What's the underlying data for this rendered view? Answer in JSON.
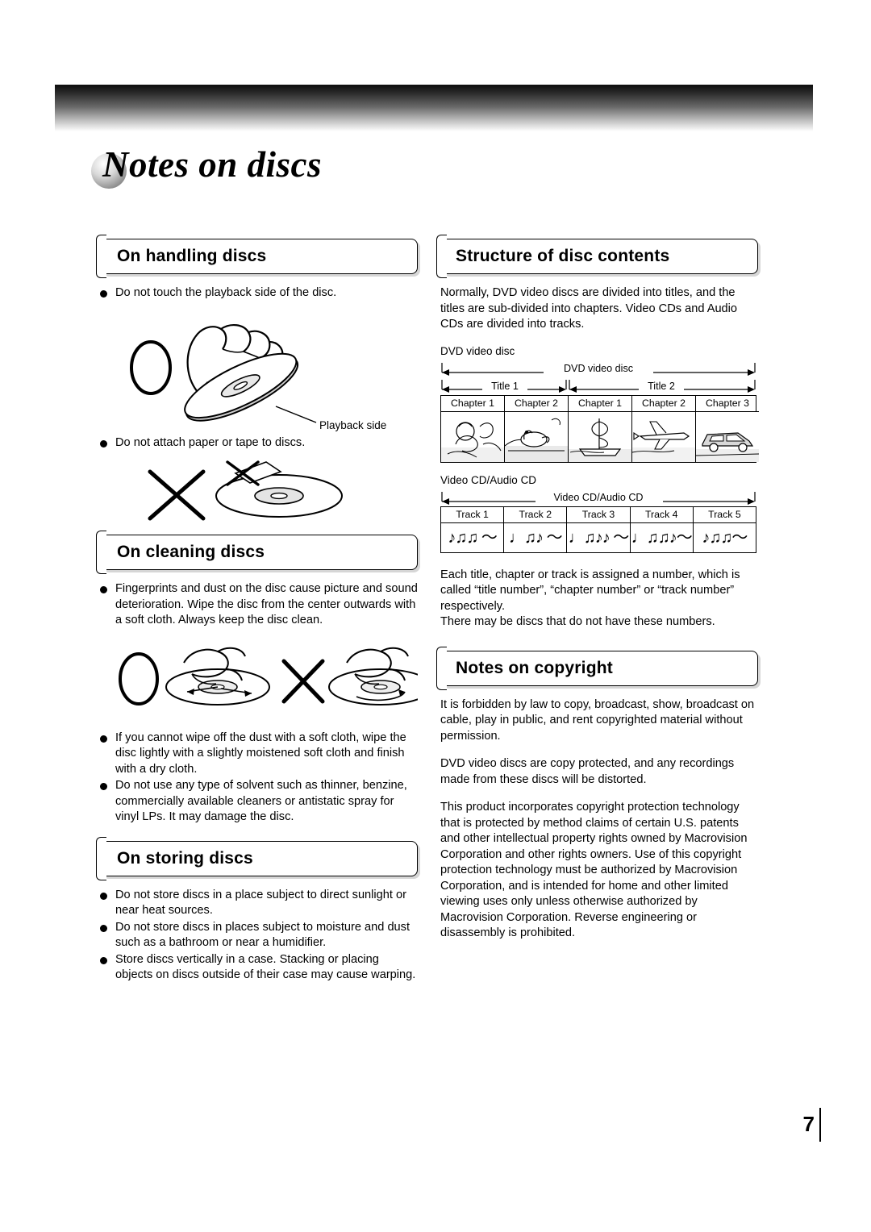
{
  "page": {
    "title": "Notes on discs",
    "number": "7"
  },
  "left": {
    "handling": {
      "heading": "On handling discs",
      "items": [
        "Do not touch the playback side of the disc.",
        "Do not attach paper or tape to discs."
      ],
      "playback_side_label": "Playback side"
    },
    "cleaning": {
      "heading": "On cleaning discs",
      "items": [
        "Fingerprints and dust on the disc cause picture and sound deterioration. Wipe the disc from the center outwards with a soft cloth. Always keep the disc clean.",
        "If you cannot wipe off the dust with a soft cloth, wipe the disc lightly with a slightly moistened soft cloth and finish with a dry cloth.",
        "Do not use any type of solvent such as thinner, benzine, commercially available cleaners or antistatic spray for vinyl LPs. It may damage the disc."
      ]
    },
    "storing": {
      "heading": "On storing discs",
      "items": [
        "Do not store discs in a place subject to direct sunlight or near heat sources.",
        "Do not store discs in places subject to moisture and dust such as a bathroom or near a humidifier.",
        "Store discs vertically in a case. Stacking or placing objects on discs outside of their case may cause warping."
      ]
    }
  },
  "right": {
    "structure": {
      "heading": "Structure of disc contents",
      "intro": "Normally, DVD video discs are divided into titles, and the titles are sub-divided into chapters. Video CDs and Audio CDs are divided into tracks.",
      "dvd_caption": "DVD video disc",
      "dvd_top_label": "DVD video disc",
      "dvd_titles": [
        "Title 1",
        "Title 2"
      ],
      "dvd_chapters": [
        "Chapter 1",
        "Chapter 2",
        "Chapter 1",
        "Chapter 2",
        "Chapter 3"
      ],
      "cd_caption": "Video CD/Audio CD",
      "cd_top_label": "Video CD/Audio CD",
      "cd_tracks": [
        "Track 1",
        "Track 2",
        "Track 3",
        "Track 4",
        "Track 5"
      ],
      "cd_notes": [
        "♪♫♫ 〜",
        "♩♫♪ 〜",
        "♩♫♪♪ 〜",
        "♩♫♫♪〜",
        "♪♫♫〜"
      ],
      "outro1": "Each title, chapter or track is assigned a number, which is called “title number”, “chapter number” or “track number” respectively.",
      "outro2": "There may be discs that do not have these numbers."
    },
    "copyright": {
      "heading": "Notes on copyright",
      "paragraphs": [
        "It is forbidden by law to copy, broadcast, show, broadcast on cable, play in public, and rent copyrighted material without permission.",
        "DVD video discs are copy protected, and any recordings made from these discs will be distorted.",
        "This product incorporates copyright protection technology that is protected by method claims of certain U.S. patents and other intellectual property rights owned by Macrovision Corporation and other rights owners. Use of this copyright protection technology must be authorized by Macrovision Corporation, and is intended for home and other limited viewing uses only unless otherwise authorized by Macrovision Corporation. Reverse engineering or disassembly is prohibited."
      ]
    }
  }
}
